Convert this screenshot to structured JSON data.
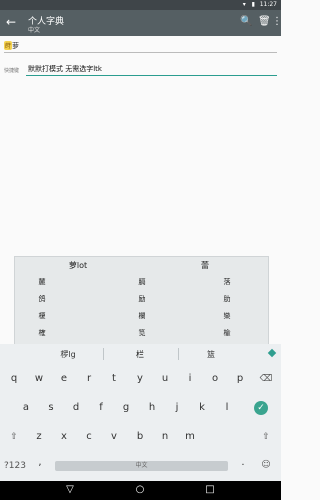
{
  "status_bar": {
    "time": "11:27",
    "icons": "▾ ▮"
  },
  "app_bar": {
    "back_icon": "←",
    "title": "个人字典",
    "subtitle": "中文",
    "search_icon": "🔍",
    "delete_icon": "🗑",
    "more_icon": "⋮"
  },
  "entry": {
    "tag_text": "莳",
    "tag_suffix": "萝",
    "field_label": "快捷键",
    "field_value": "默默打模式  无需选字ltk"
  },
  "candidates": {
    "header": [
      "萝lot",
      "蕾"
    ],
    "rows": [
      [
        "麓",
        "膈",
        "落"
      ],
      [
        "鸽",
        "励",
        "肋"
      ],
      [
        "榎",
        "欄",
        "欒"
      ],
      [
        "榷",
        "笕",
        "楡"
      ]
    ]
  },
  "suggestions": [
    "椤lg",
    "栏",
    "篮"
  ],
  "keyboard": {
    "row1": [
      "q",
      "w",
      "e",
      "r",
      "t",
      "y",
      "u",
      "i",
      "o",
      "p"
    ],
    "row2": [
      "a",
      "s",
      "d",
      "f",
      "g",
      "h",
      "j",
      "k",
      "l"
    ],
    "row3": [
      "z",
      "x",
      "c",
      "v",
      "b",
      "n",
      "m"
    ],
    "shift_left": "⇧",
    "shift_right": "⇧",
    "backspace": "⌫",
    "enter": "✓",
    "symbols": "?123",
    "comma": ",",
    "space_label": "中文",
    "period": ".",
    "emoji": "☺"
  },
  "nav_bar": {
    "back": "▽",
    "home": "○",
    "recents": "□"
  }
}
